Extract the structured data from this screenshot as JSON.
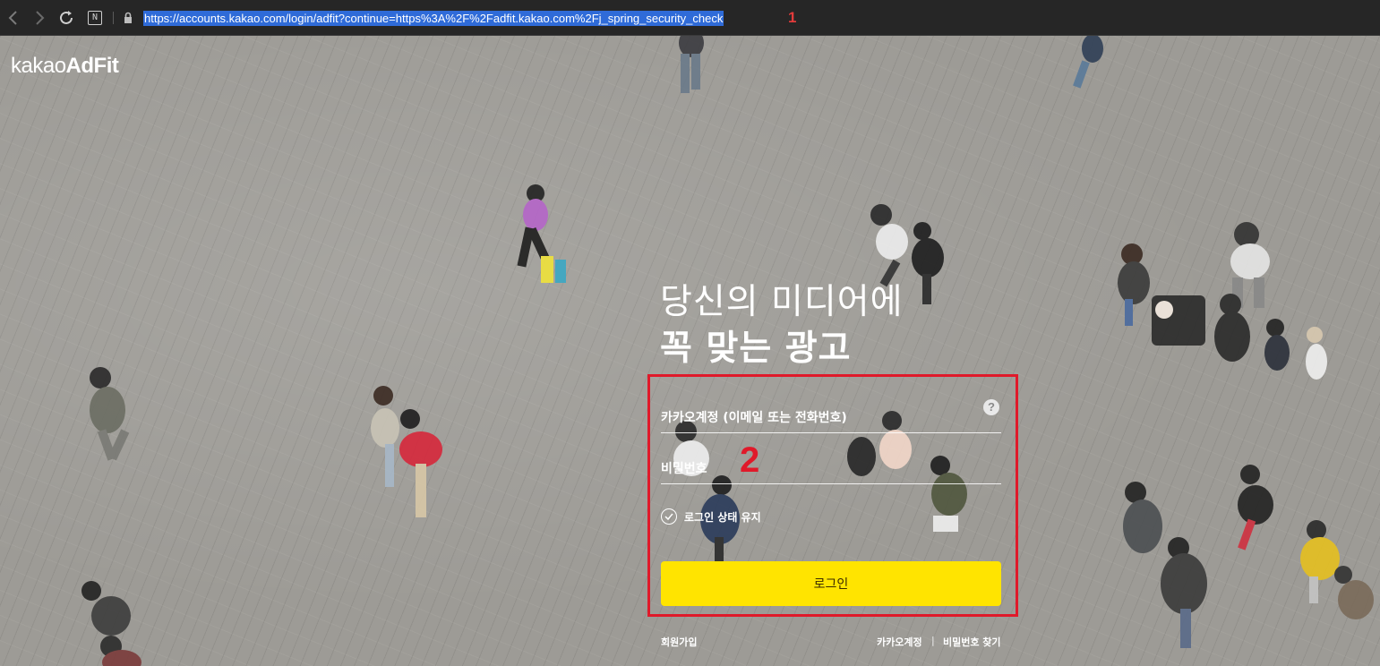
{
  "browser": {
    "url": "https://accounts.kakao.com/login/adfit?continue=https%3A%2F%2Fadfit.kakao.com%2Fj_spring_security_check",
    "annotation_1": "1",
    "nav_icons": [
      "back-arrow-icon",
      "forward-arrow-icon",
      "reload-icon",
      "n-bookmark-icon",
      "lock-icon"
    ],
    "n_icon_label": "N"
  },
  "brand": {
    "logo_light": "kakao",
    "logo_bold": "AdFit"
  },
  "hero": {
    "line1": "당신의 미디어에",
    "line2": "꼭 맞는 광고"
  },
  "login_form": {
    "email_placeholder": "카카오계정 (이메일 또는 전화번호)",
    "password_placeholder": "비밀번호",
    "help_label": "?",
    "annotation_2": "2",
    "keep_login_label": "로그인 상태 유지",
    "submit_label": "로그인",
    "highlight_color": "#e0192a",
    "button_color": "#ffe400"
  },
  "footer_links": {
    "signup": "회원가입",
    "kakao_account": "카카오계정",
    "divider": "|",
    "find_password": "비밀번호 찾기"
  }
}
